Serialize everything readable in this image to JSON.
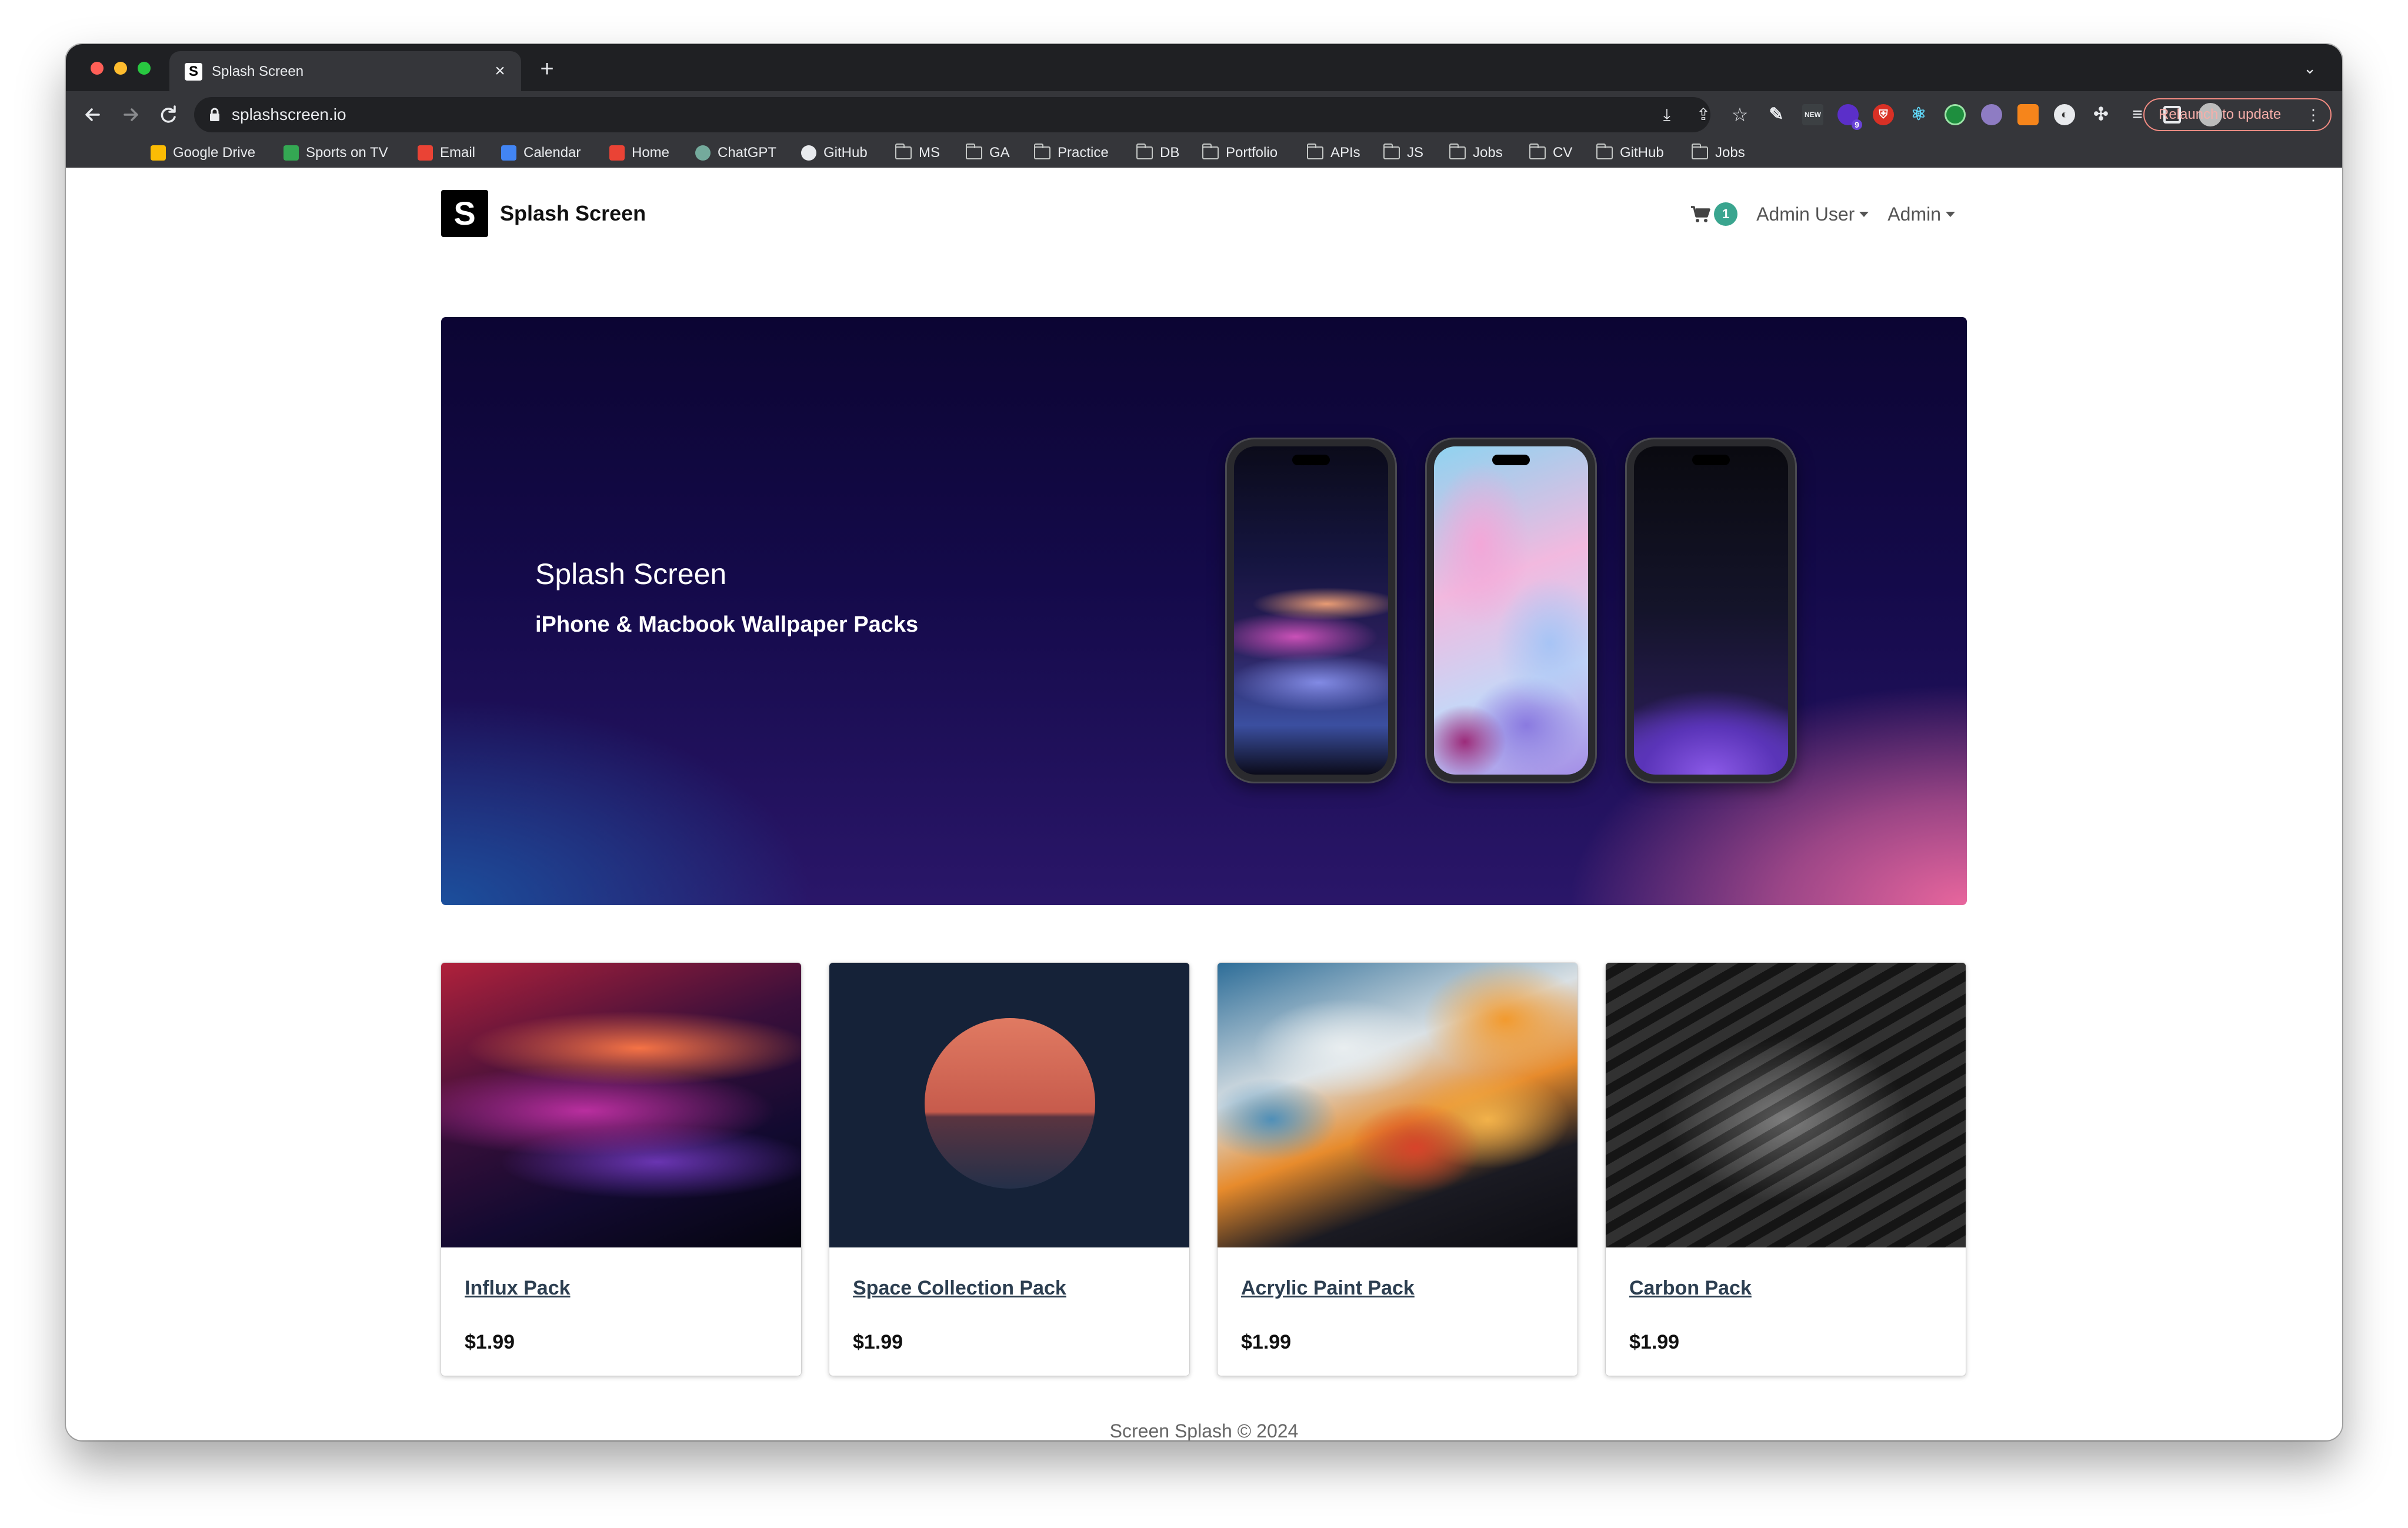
{
  "browser": {
    "tab_title": "Splash Screen",
    "tab_favicon_letter": "S",
    "tab_close": "×",
    "new_tab": "+",
    "tab_list": "⌄",
    "url": "splashscreen.io",
    "relaunch_label": "Relaunch to update",
    "relaunch_menu": "⋮",
    "extension_new_label": "NEW",
    "extension_badge_count": "9",
    "bookmarks": [
      {
        "label": "Google Drive",
        "icon": "google-drive-icon"
      },
      {
        "label": "Sports on TV",
        "icon": "sports-icon"
      },
      {
        "label": "Email",
        "icon": "gmail-icon"
      },
      {
        "label": "Calendar",
        "icon": "calendar-icon"
      },
      {
        "label": "Home",
        "icon": "maps-pin-icon"
      },
      {
        "label": "ChatGPT",
        "icon": "chatgpt-icon"
      },
      {
        "label": "GitHub",
        "icon": "github-icon"
      },
      {
        "label": "MS",
        "icon": "folder-icon"
      },
      {
        "label": "GA",
        "icon": "folder-icon"
      },
      {
        "label": "Practice",
        "icon": "folder-icon"
      },
      {
        "label": "DB",
        "icon": "folder-icon"
      },
      {
        "label": "Portfolio",
        "icon": "folder-icon"
      },
      {
        "label": "APIs",
        "icon": "folder-icon"
      },
      {
        "label": "JS",
        "icon": "folder-icon"
      },
      {
        "label": "Jobs",
        "icon": "folder-icon"
      },
      {
        "label": "CV",
        "icon": "folder-icon"
      },
      {
        "label": "GitHub",
        "icon": "folder-icon"
      },
      {
        "label": "Jobs",
        "icon": "folder-icon"
      }
    ]
  },
  "site": {
    "logo_letter": "S",
    "brand_name": "Splash Screen",
    "cart_count": "1",
    "user_menu": "Admin User",
    "admin_menu": "Admin"
  },
  "hero": {
    "title": "Splash Screen",
    "subtitle": "iPhone & Macbook Wallpaper Packs"
  },
  "products": [
    {
      "name": "Influx Pack",
      "price": "$1.99"
    },
    {
      "name": "Space Collection Pack",
      "price": "$1.99"
    },
    {
      "name": "Acrylic Paint Pack",
      "price": "$1.99"
    },
    {
      "name": "Carbon Pack",
      "price": "$1.99"
    }
  ],
  "footer": {
    "text": "Screen Splash © 2024"
  },
  "colors": {
    "accent_badge": "#3aa58f",
    "browser_frame": "#35363a",
    "relaunch_border": "#f28b82"
  }
}
